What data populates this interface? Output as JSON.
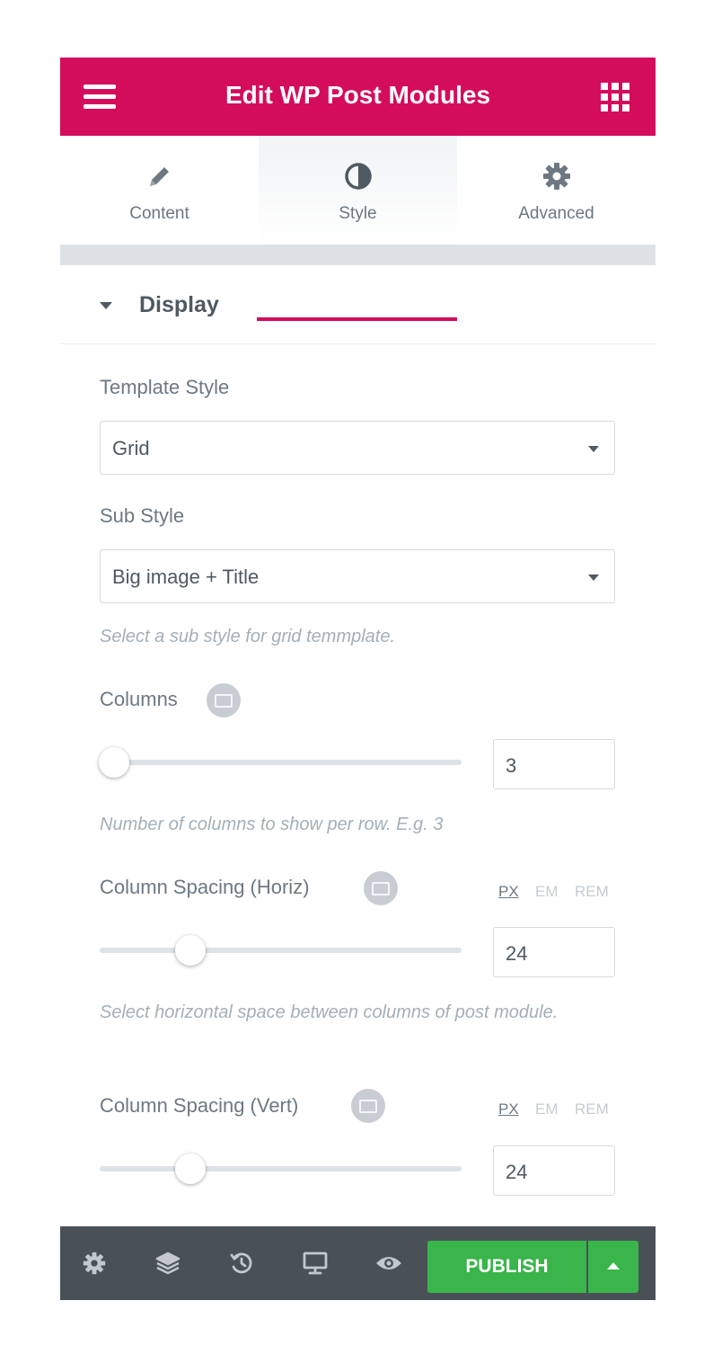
{
  "header": {
    "title": "Edit WP Post Modules",
    "menu_icon": "hamburger-icon",
    "apps_icon": "grid-icon",
    "color": "#d30c5c"
  },
  "tabs": [
    {
      "label": "Content",
      "icon": "pencil-icon",
      "active": false
    },
    {
      "label": "Style",
      "icon": "half-circle-icon",
      "active": true
    },
    {
      "label": "Advanced",
      "icon": "gear-icon",
      "active": false
    }
  ],
  "section": {
    "title": "Display",
    "expanded": true
  },
  "controls": {
    "template_style": {
      "label": "Template Style",
      "value": "Grid"
    },
    "sub_style": {
      "label": "Sub Style",
      "value": "Big image + Title",
      "hint": "Select a sub style for grid temmplate."
    },
    "columns": {
      "label": "Columns",
      "value": "3",
      "hint": "Number of columns to show per row. E.g. 3",
      "slider_fraction": 0.03
    },
    "spacing_horiz": {
      "label": "Column Spacing (Horiz)",
      "value": "24",
      "hint": "Select horizontal space between columns of post module.",
      "units": [
        "PX",
        "EM",
        "REM"
      ],
      "active_unit": "PX",
      "slider_fraction": 0.24
    },
    "spacing_vert": {
      "label": "Column Spacing (Vert)",
      "value": "24",
      "units": [
        "PX",
        "EM",
        "REM"
      ],
      "active_unit": "PX",
      "slider_fraction": 0.24
    }
  },
  "footer": {
    "icons": [
      "settings-icon",
      "layers-icon",
      "history-icon",
      "responsive-icon",
      "preview-icon"
    ],
    "publish_label": "PUBLISH",
    "publish_color": "#39b54a"
  }
}
